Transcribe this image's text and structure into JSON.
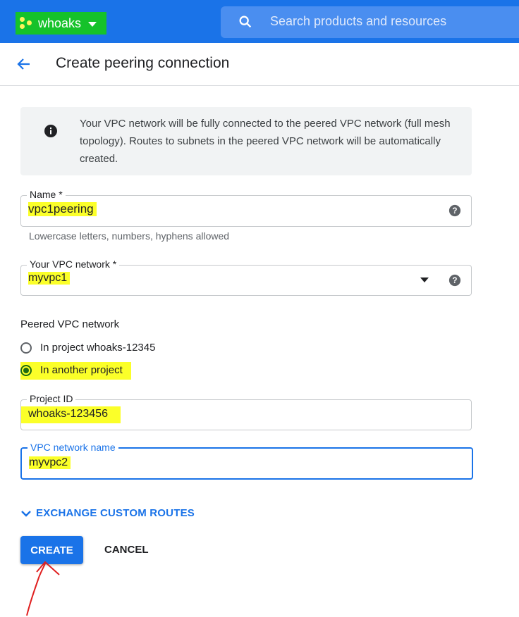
{
  "topbar": {
    "project_name": "whoaks",
    "search_placeholder": "Search products and resources"
  },
  "header": {
    "title": "Create peering connection"
  },
  "info": {
    "message": "Your VPC network will be fully connected to the peered VPC network (full mesh topology). Routes to subnets in the peered VPC network will be automatically created."
  },
  "form": {
    "name": {
      "label": "Name *",
      "value": "vpc1peering",
      "hint": "Lowercase letters, numbers, hyphens allowed"
    },
    "your_network": {
      "label": "Your VPC network *",
      "value": "myvpc1"
    },
    "peered": {
      "label": "Peered VPC network",
      "options": [
        {
          "label": "In project whoaks-12345",
          "selected": false
        },
        {
          "label": "In another project",
          "selected": true
        }
      ]
    },
    "project_id": {
      "label": "Project ID",
      "value": "whoaks-123456"
    },
    "vpc_network_name": {
      "label": "VPC network name",
      "value": "myvpc2"
    }
  },
  "exchange_label": "EXCHANGE CUSTOM ROUTES",
  "buttons": {
    "create": "CREATE",
    "cancel": "CANCEL"
  },
  "colors": {
    "primary": "#1a73e8",
    "highlight": "#fbff29",
    "annotation": "#e02020"
  }
}
